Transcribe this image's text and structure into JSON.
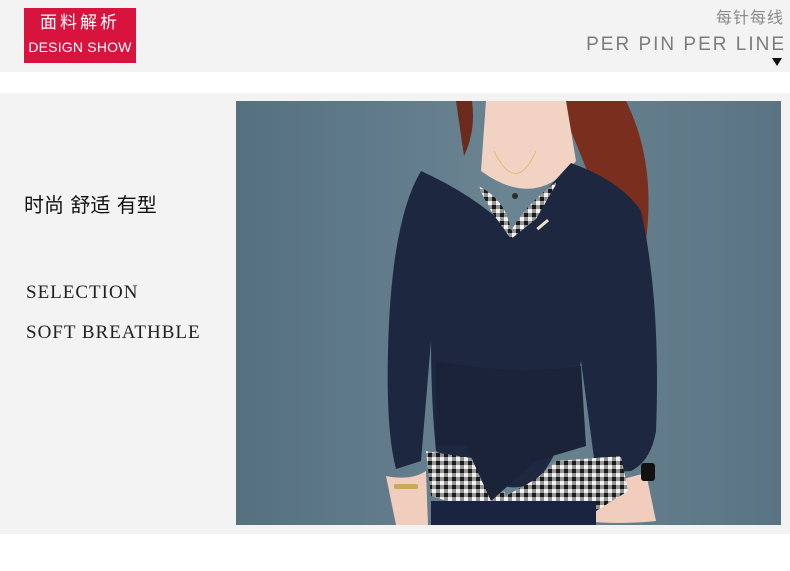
{
  "badge": {
    "title_cn": "面料解析",
    "title_en": "DESIGN SHOW"
  },
  "header": {
    "title_cn": "每针每线",
    "title_en": "PER PIN PER LINE"
  },
  "content": {
    "tagline": "时尚 舒适 有型",
    "features": [
      "SELECTION",
      "SOFT BREATHBLE"
    ]
  },
  "colors": {
    "accent": "#d8133d",
    "panel_bg": "#f3f3f3",
    "photo_bg": "#5f7888",
    "garment": "#1e2740"
  },
  "icons": {
    "scroll_hint": "triangle-down-icon"
  }
}
